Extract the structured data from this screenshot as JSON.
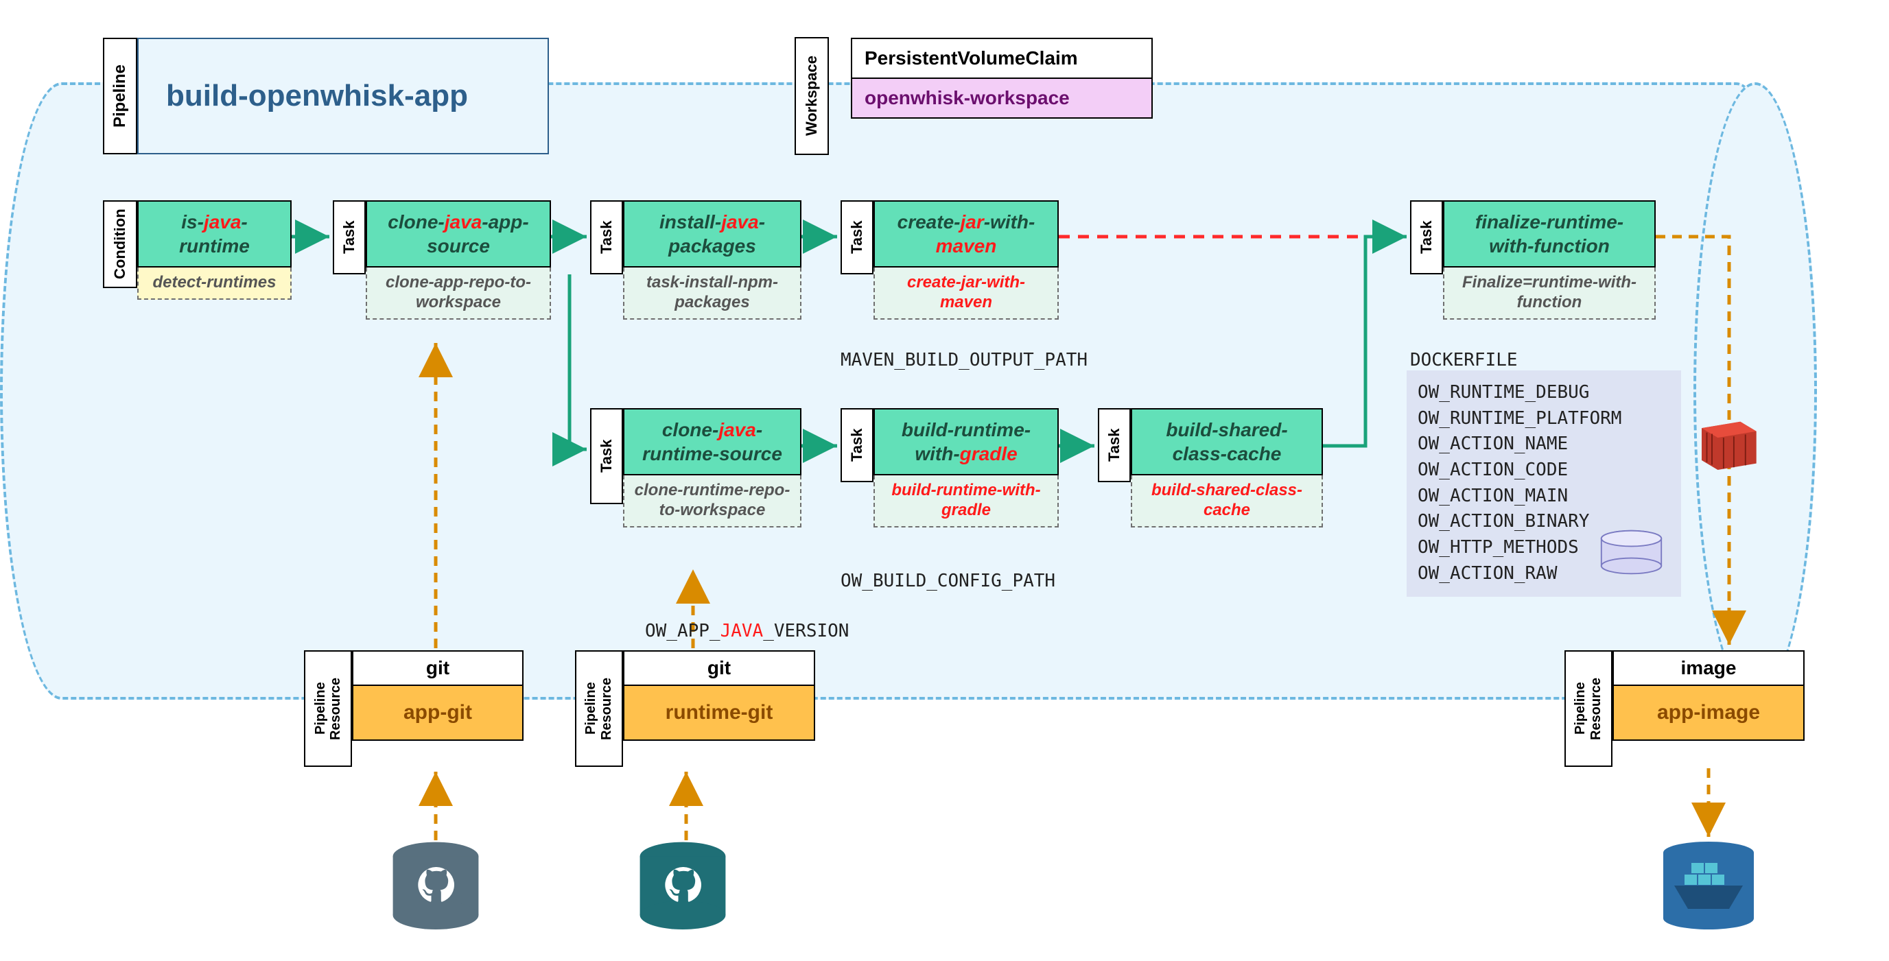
{
  "pipeline_label": "Pipeline",
  "pipeline_title": "build-openwhisk-app",
  "workspace": {
    "label": "Workspace",
    "top": "PersistentVolumeClaim",
    "bottom": "openwhisk-workspace"
  },
  "condition": {
    "label": "Condition",
    "head_pre": "is-",
    "head_hl": "java",
    "head_post": "-runtime",
    "sub": "detect-runtimes"
  },
  "tasks": {
    "label": "Task",
    "cloneApp": {
      "pre": "clone-",
      "hl": "java",
      "post": "-app-source",
      "sub": "clone-app-repo-to-workspace"
    },
    "installPkg": {
      "pre": "install-",
      "hl": "java",
      "post": "-packages",
      "sub": "task-install-npm-packages"
    },
    "createJar": {
      "pre": "create-",
      "hl": "jar",
      "post": "-with-",
      "hl2": "maven",
      "sub": "create-jar-with-maven"
    },
    "cloneRuntime": {
      "pre": "clone-",
      "hl": "java",
      "post": "-runtime-source",
      "sub": "clone-runtime-repo-to-workspace"
    },
    "buildGradle": {
      "pre": "build-runtime-with-",
      "hl": "gradle",
      "sub": "build-runtime-with-gradle"
    },
    "sharedCache": {
      "text": "build-shared-class-cache",
      "sub": "build-shared-class-cache"
    },
    "finalize": {
      "text": "finalize-runtime-with-function",
      "sub": "Finalize=runtime-with-function"
    }
  },
  "labels": {
    "maven_path": "MAVEN_BUILD_OUTPUT_PATH",
    "build_config": "OW_BUILD_CONFIG_PATH",
    "app_java_ver_pre": "OW_APP_",
    "app_java_ver_hl": "JAVA",
    "app_java_ver_post": "_VERSION",
    "dockerfile": "DOCKERFILE"
  },
  "env": [
    "OW_RUNTIME_DEBUG",
    "OW_RUNTIME_PLATFORM",
    "OW_ACTION_NAME",
    "OW_ACTION_CODE",
    "OW_ACTION_MAIN",
    "OW_ACTION_BINARY",
    "OW_HTTP_METHODS",
    "OW_ACTION_RAW"
  ],
  "resources": {
    "label": "Pipeline Resource",
    "appGit": {
      "type": "git",
      "name": "app-git"
    },
    "runtimeGit": {
      "type": "git",
      "name": "runtime-git"
    },
    "appImage": {
      "type": "image",
      "name": "app-image"
    }
  }
}
